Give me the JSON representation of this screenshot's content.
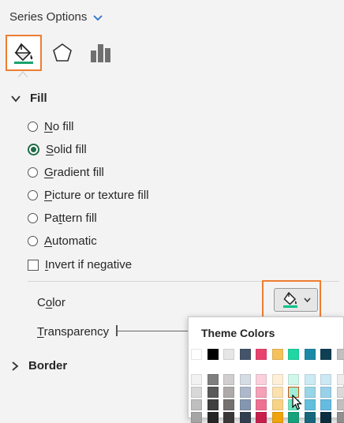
{
  "header": {
    "title": "Series Options"
  },
  "tabs": [
    {
      "name": "Fill & Line",
      "icon": "paint-bucket-icon",
      "active": true
    },
    {
      "name": "Effects",
      "icon": "pentagon-icon",
      "active": false
    },
    {
      "name": "Series Options",
      "icon": "bar-chart-icon",
      "active": false
    }
  ],
  "fill": {
    "title": "Fill",
    "options": [
      {
        "label": "No fill",
        "selected": false
      },
      {
        "label": "Solid fill",
        "selected": true
      },
      {
        "label": "Gradient fill",
        "selected": false
      },
      {
        "label": "Picture or texture fill",
        "selected": false
      },
      {
        "label": "Pattern fill",
        "selected": false
      },
      {
        "label": "Automatic",
        "selected": false
      }
    ],
    "invert_label": "Invert if negative",
    "invert_checked": false,
    "color_label": "Color",
    "color_value": "#00c48a",
    "transparency_label": "Transparency"
  },
  "border": {
    "title": "Border"
  },
  "palette": {
    "title": "Theme Colors",
    "top_row": [
      "#ffffff",
      "#000000",
      "#e7e6e6",
      "#44546a",
      "#e8436d",
      "#f5c15a",
      "#20d7a4",
      "#1c8aa6",
      "#0f3f55",
      "#c0c0c0"
    ],
    "shade_rows": [
      [
        "#f2f2f2",
        "#7f7f7f",
        "#d0cece",
        "#d6dce4",
        "#fad0dc",
        "#fdf0d6",
        "#cff7ea",
        "#cbeaf3",
        "#cce8f5",
        "#ececec"
      ],
      [
        "#d8d8d8",
        "#595959",
        "#aeaaaa",
        "#adb9ca",
        "#f5a1b7",
        "#fbe1ae",
        "#9feed5",
        "#97d5e7",
        "#99d1eb",
        "#d9d9d9"
      ],
      [
        "#bfbfbf",
        "#3f3f3f",
        "#757171",
        "#8496b0",
        "#ee7193",
        "#f9d385",
        "#6fe6c1",
        "#63bfdb",
        "#66bbe1",
        "#bfbfbf"
      ],
      [
        "#a5a5a5",
        "#262626",
        "#3a3838",
        "#323f4f",
        "#c61f4b",
        "#f0a30a",
        "#16a17b",
        "#15677c",
        "#0b2f3f",
        "#8f8f8f"
      ]
    ],
    "selected": {
      "row": 1,
      "col": 6
    }
  }
}
